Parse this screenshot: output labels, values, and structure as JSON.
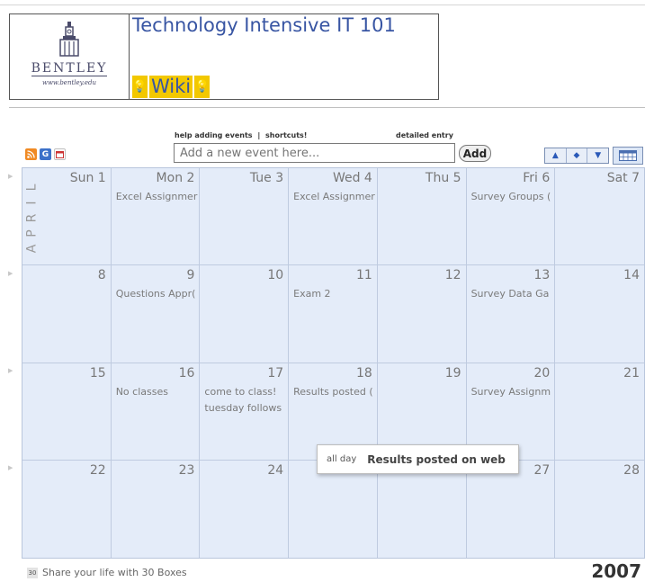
{
  "header": {
    "logo_name": "BENTLEY",
    "logo_url": "www.bentley.edu",
    "title": "Technology Intensive IT 101",
    "wiki_label": "Wiki",
    "bulb_glyph": "💡"
  },
  "toolbar": {
    "help_link": "help adding events",
    "separator": "|",
    "shortcuts_link": "shortcuts!",
    "detailed_entry": "detailed entry",
    "add_placeholder": "Add a new event here...",
    "add_button": "Add",
    "feed_icons": [
      "rss-icon",
      "google-icon",
      "calendar-export-icon"
    ],
    "nav": [
      "▲",
      "◆",
      "▼"
    ]
  },
  "calendar": {
    "month": "APRIL",
    "year": "2007",
    "weeks": [
      [
        {
          "day": "Sun 1",
          "events": []
        },
        {
          "day": "Mon 2",
          "events": [
            "Excel Assignmer"
          ]
        },
        {
          "day": "Tue 3",
          "events": []
        },
        {
          "day": "Wed 4",
          "events": [
            "Excel Assignmer"
          ]
        },
        {
          "day": "Thu 5",
          "events": []
        },
        {
          "day": "Fri 6",
          "events": [
            "Survey Groups ("
          ]
        },
        {
          "day": "Sat 7",
          "events": []
        }
      ],
      [
        {
          "day": "8",
          "events": []
        },
        {
          "day": "9",
          "events": [
            "Questions Appr("
          ]
        },
        {
          "day": "10",
          "events": []
        },
        {
          "day": "11",
          "events": [
            "Exam 2"
          ]
        },
        {
          "day": "12",
          "events": []
        },
        {
          "day": "13",
          "events": [
            "Survey Data Ga"
          ]
        },
        {
          "day": "14",
          "events": []
        }
      ],
      [
        {
          "day": "15",
          "events": []
        },
        {
          "day": "16",
          "events": [
            "No classes"
          ]
        },
        {
          "day": "17",
          "events": [
            "come to class!",
            "tuesday follows"
          ]
        },
        {
          "day": "18",
          "events": [
            "Results posted ("
          ]
        },
        {
          "day": "19",
          "events": []
        },
        {
          "day": "20",
          "events": [
            "Survey Assignm"
          ]
        },
        {
          "day": "21",
          "events": []
        }
      ],
      [
        {
          "day": "22",
          "events": []
        },
        {
          "day": "23",
          "events": []
        },
        {
          "day": "24",
          "events": []
        },
        {
          "day": "25",
          "events": []
        },
        {
          "day": "26",
          "events": []
        },
        {
          "day": "27",
          "events": []
        },
        {
          "day": "28",
          "events": []
        }
      ]
    ]
  },
  "tooltip": {
    "all_day": "all day",
    "title": "Results posted on web"
  },
  "footer": {
    "logo_text": "30",
    "text": "Share your life with 30 Boxes"
  }
}
